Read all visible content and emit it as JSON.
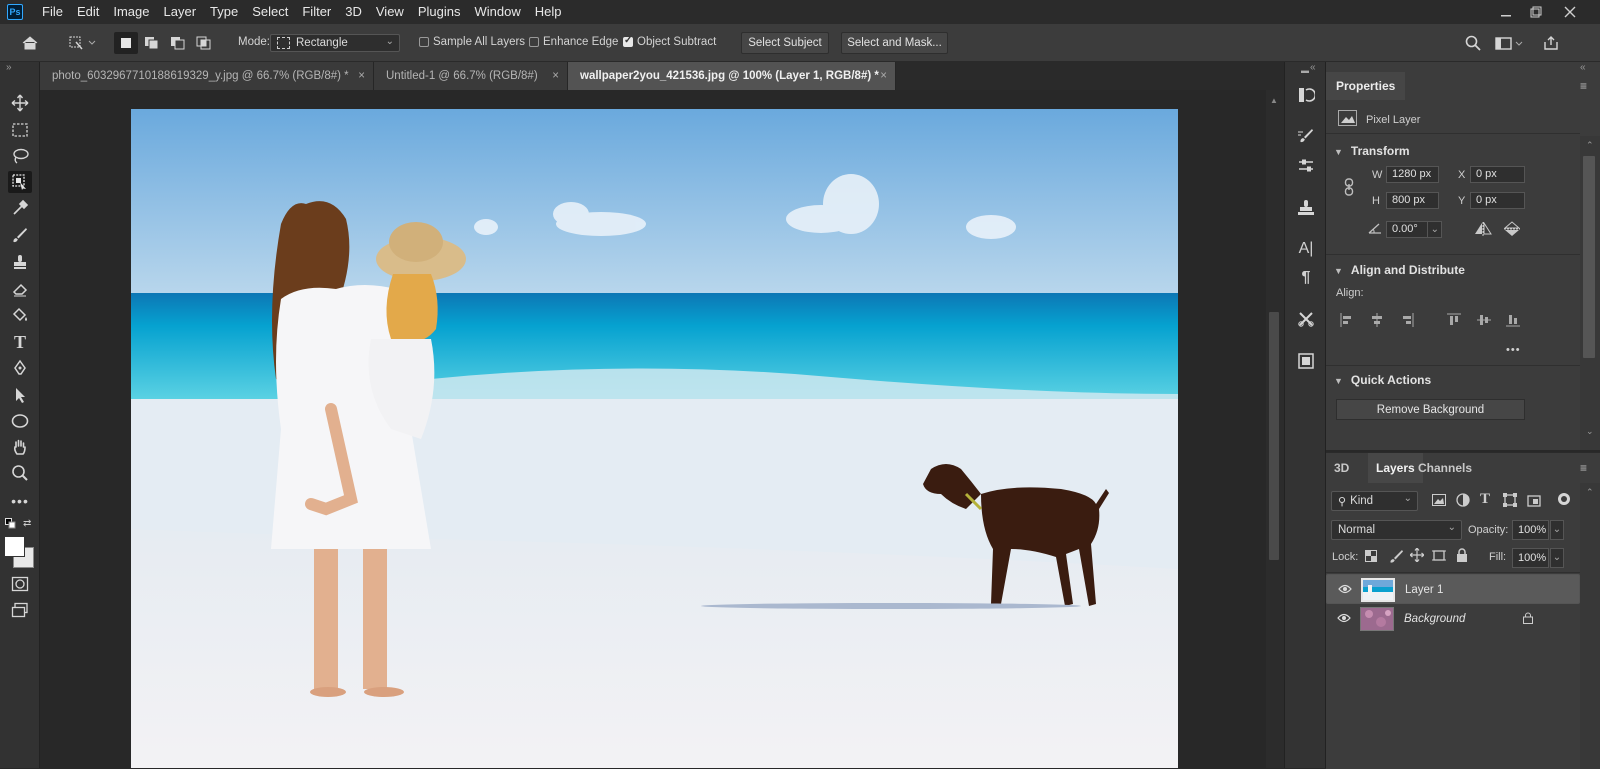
{
  "menubar": {
    "logo": "Ps",
    "items": [
      "File",
      "Edit",
      "Image",
      "Layer",
      "Type",
      "Select",
      "Filter",
      "3D",
      "View",
      "Plugins",
      "Window",
      "Help"
    ],
    "minimize_icon": "minimize-icon",
    "restore_icon": "restore-icon",
    "close_icon": "close-icon"
  },
  "options_bar": {
    "mode_label": "Mode:",
    "mode_value": "Rectangle",
    "sample_all_layers": {
      "label": "Sample All Layers",
      "checked": false
    },
    "enhance_edge": {
      "label": "Enhance Edge",
      "checked": false
    },
    "object_subtract": {
      "label": "Object Subtract",
      "checked": true
    },
    "select_subject": "Select Subject",
    "select_and_mask": "Select and Mask..."
  },
  "tabs": [
    {
      "label": "photo_6032967710188619329_y.jpg @ 66.7% (RGB/8#) *",
      "active": false
    },
    {
      "label": "Untitled-1 @ 66.7% (RGB/8#)",
      "active": false
    },
    {
      "label": "wallpaper2you_421536.jpg @ 100% (Layer 1, RGB/8#) *",
      "active": true
    }
  ],
  "tab_close": "×",
  "properties": {
    "tab": "Properties",
    "layer_type": "Pixel Layer",
    "transform": {
      "title": "Transform",
      "w_label": "W",
      "w_value": "1280 px",
      "h_label": "H",
      "h_value": "800 px",
      "x_label": "X",
      "x_value": "0 px",
      "y_label": "Y",
      "y_value": "0 px",
      "angle_value": "0.00°"
    },
    "align": {
      "title": "Align and Distribute",
      "label": "Align:",
      "more": "•••"
    },
    "quick_actions": {
      "title": "Quick Actions",
      "remove_bg": "Remove Background"
    }
  },
  "layers_panel": {
    "tabs": [
      "3D",
      "Layers",
      "Channels"
    ],
    "active_tab": "Layers",
    "filter_kind": "Kind",
    "blend_mode": "Normal",
    "opacity_label": "Opacity:",
    "opacity_value": "100%",
    "lock_label": "Lock:",
    "fill_label": "Fill:",
    "fill_value": "100%",
    "layers": [
      {
        "name": "Layer 1",
        "selected": true,
        "visible": true,
        "locked": false
      },
      {
        "name": "Background",
        "selected": false,
        "visible": true,
        "locked": true
      }
    ]
  },
  "canvas": {
    "description_elements": [
      "sky",
      "sea",
      "beach",
      "woman",
      "child",
      "dog"
    ]
  }
}
